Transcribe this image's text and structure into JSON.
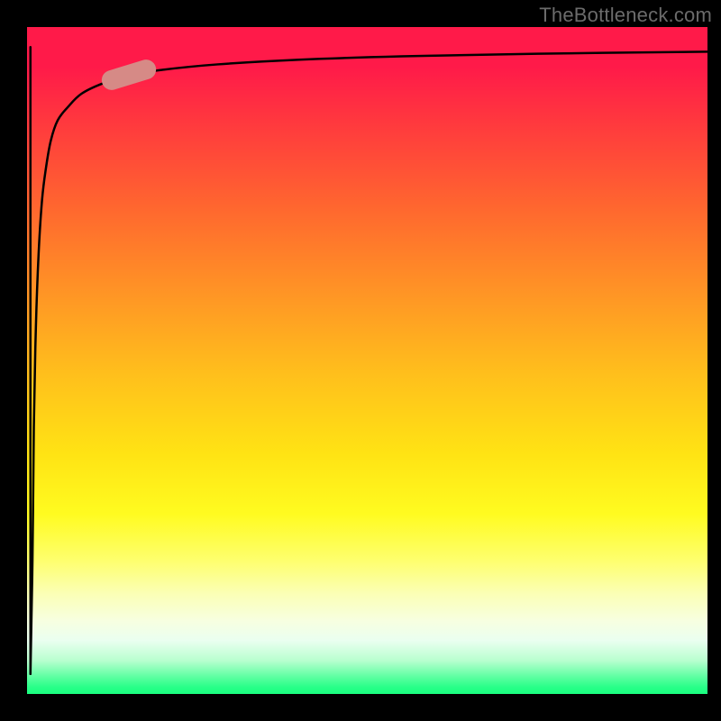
{
  "attribution": "TheBottleneck.com",
  "colors": {
    "frame": "#000000",
    "curve": "#000000",
    "pill": "#d68a86",
    "attribution_text": "#6b6b6b",
    "gradient_stops": [
      "#ff1a49",
      "#ff6a2e",
      "#ffbf1c",
      "#fffb20",
      "#feff6e",
      "#b8ffcf",
      "#1aff80"
    ]
  },
  "chart_data": {
    "type": "line",
    "title": "",
    "xlabel": "",
    "ylabel": "",
    "xlim": [
      0,
      100
    ],
    "ylim": [
      0,
      100
    ],
    "grid": false,
    "legend": false,
    "series": [
      {
        "name": "bottleneck-curve",
        "x": [
          0.5,
          0.8,
          1.0,
          1.3,
          1.7,
          2.2,
          2.8,
          3.5,
          4.5,
          6,
          8,
          11,
          15,
          20,
          28,
          40,
          55,
          75,
          100
        ],
        "y": [
          3,
          20,
          40,
          55,
          66,
          74,
          79,
          83,
          86,
          88,
          90,
          91.5,
          92.8,
          93.6,
          94.4,
          95.1,
          95.6,
          96.0,
          96.3
        ]
      },
      {
        "name": "initial-drop",
        "x": [
          0.5,
          0.5
        ],
        "y": [
          97,
          3
        ]
      }
    ],
    "marker": {
      "name": "pill",
      "x": 15,
      "y": 92.8,
      "angle_deg_from_horizontal": 17
    }
  }
}
